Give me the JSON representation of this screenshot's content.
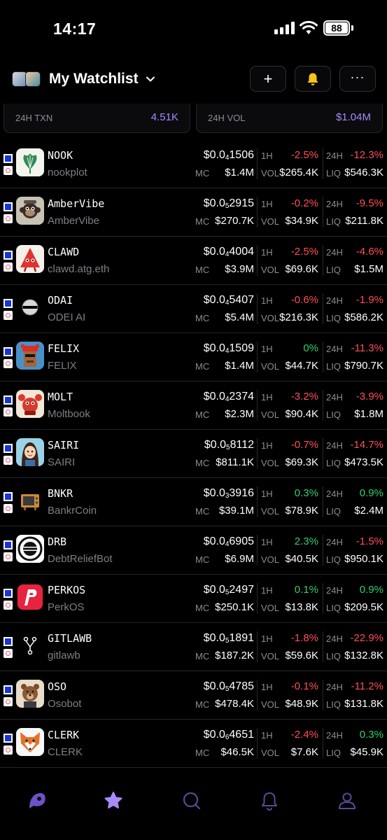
{
  "status_bar": {
    "time": "14:17",
    "battery": "88"
  },
  "header": {
    "title": "My Watchlist"
  },
  "stats": {
    "txn_label": "24H TXN",
    "txn_value": "4.51K",
    "vol_label": "24H VOL",
    "vol_value": "$1.04M"
  },
  "labels": {
    "mc": "MC",
    "vol": "VOL",
    "h1": "1H",
    "h24": "24H",
    "liq": "LIQ"
  },
  "colors": {
    "accent": "#a78bfa",
    "positive": "#2fd16b",
    "negative": "#ff4d5a"
  },
  "tokens": [
    {
      "symbol": "NOOK",
      "name": "nookplot",
      "price_prefix": "$0.0",
      "price_zeros": "4",
      "price_digits": "1506",
      "mc": "$1.4M",
      "change_1h": "-2.5%",
      "change_1h_dir": "neg",
      "vol": "$265.4K",
      "change_24h": "-12.3%",
      "change_24h_dir": "neg",
      "liq": "$546.3K",
      "icon": "ginkgo-leaf-icon"
    },
    {
      "symbol": "AmberVibe",
      "name": "AmberVibe",
      "price_prefix": "$0.0",
      "price_zeros": "5",
      "price_digits": "2915",
      "mc": "$270.7K",
      "change_1h": "-0.2%",
      "change_1h_dir": "neg",
      "vol": "$34.9K",
      "change_24h": "-9.5%",
      "change_24h_dir": "neg",
      "liq": "$211.8K",
      "icon": "monkey-avatar-icon"
    },
    {
      "symbol": "CLAWD",
      "name": "clawd.atg.eth",
      "price_prefix": "$0.0",
      "price_zeros": "4",
      "price_digits": "4004",
      "mc": "$3.9M",
      "change_1h": "-2.5%",
      "change_1h_dir": "neg",
      "vol": "$69.6K",
      "change_24h": "-4.6%",
      "change_24h_dir": "neg",
      "liq": "$1.5M",
      "icon": "red-claw-icon"
    },
    {
      "symbol": "ODAI",
      "name": "ODEI AI",
      "price_prefix": "$0.0",
      "price_zeros": "4",
      "price_digits": "5407",
      "mc": "$5.4M",
      "change_1h": "-0.6%",
      "change_1h_dir": "neg",
      "vol": "$216.3K",
      "change_24h": "-1.9%",
      "change_24h_dir": "neg",
      "liq": "$586.2K",
      "icon": "orb-icon"
    },
    {
      "symbol": "FELIX",
      "name": "FELIX",
      "price_prefix": "$0.0",
      "price_zeros": "4",
      "price_digits": "1509",
      "mc": "$1.4M",
      "change_1h": "0%",
      "change_1h_dir": "pos",
      "vol": "$44.7K",
      "change_24h": "-11.3%",
      "change_24h_dir": "neg",
      "liq": "$790.7K",
      "icon": "pixel-punk-icon"
    },
    {
      "symbol": "MOLT",
      "name": "Moltbook",
      "price_prefix": "$0.0",
      "price_zeros": "4",
      "price_digits": "2374",
      "mc": "$2.3M",
      "change_1h": "-3.2%",
      "change_1h_dir": "neg",
      "vol": "$90.4K",
      "change_24h": "-3.9%",
      "change_24h_dir": "neg",
      "liq": "$1.8M",
      "icon": "red-crab-icon"
    },
    {
      "symbol": "SAIRI",
      "name": "SAIRI",
      "price_prefix": "$0.0",
      "price_zeros": "5",
      "price_digits": "8112",
      "mc": "$811.1K",
      "change_1h": "-0.7%",
      "change_1h_dir": "neg",
      "vol": "$69.3K",
      "change_24h": "-14.7%",
      "change_24h_dir": "neg",
      "liq": "$473.5K",
      "icon": "girl-avatar-icon"
    },
    {
      "symbol": "BNKR",
      "name": "BankrCoin",
      "price_prefix": "$0.0",
      "price_zeros": "3",
      "price_digits": "3916",
      "mc": "$39.1M",
      "change_1h": "0.3%",
      "change_1h_dir": "pos",
      "vol": "$78.9K",
      "change_24h": "0.9%",
      "change_24h_dir": "pos",
      "liq": "$2.4M",
      "icon": "tv-icon"
    },
    {
      "symbol": "DRB",
      "name": "DebtReliefBot",
      "price_prefix": "$0.0",
      "price_zeros": "4",
      "price_digits": "6905",
      "mc": "$6.9M",
      "change_1h": "2.3%",
      "change_1h_dir": "pos",
      "vol": "$40.5K",
      "change_24h": "-1.5%",
      "change_24h_dir": "neg",
      "liq": "$950.1K",
      "icon": "seal-badge-icon"
    },
    {
      "symbol": "PERKOS",
      "name": "PerkOS",
      "price_prefix": "$0.0",
      "price_zeros": "5",
      "price_digits": "2497",
      "mc": "$250.1K",
      "change_1h": "0.1%",
      "change_1h_dir": "pos",
      "vol": "$13.8K",
      "change_24h": "0.9%",
      "change_24h_dir": "pos",
      "liq": "$209.5K",
      "icon": "p-logo-icon"
    },
    {
      "symbol": "GITLAWB",
      "name": "gitlawb",
      "price_prefix": "$0.0",
      "price_zeros": "5",
      "price_digits": "1891",
      "mc": "$187.2K",
      "change_1h": "-1.8%",
      "change_1h_dir": "neg",
      "vol": "$59.6K",
      "change_24h": "-22.9%",
      "change_24h_dir": "neg",
      "liq": "$132.8K",
      "icon": "git-branch-icon"
    },
    {
      "symbol": "OSO",
      "name": "Osobot",
      "price_prefix": "$0.0",
      "price_zeros": "5",
      "price_digits": "4785",
      "mc": "$478.4K",
      "change_1h": "-0.1%",
      "change_1h_dir": "neg",
      "vol": "$48.9K",
      "change_24h": "-11.2%",
      "change_24h_dir": "neg",
      "liq": "$131.8K",
      "icon": "bear-icon"
    },
    {
      "symbol": "CLERK",
      "name": "CLERK",
      "price_prefix": "$0.0",
      "price_zeros": "6",
      "price_digits": "4651",
      "mc": "$46.5K",
      "change_1h": "-2.4%",
      "change_1h_dir": "neg",
      "vol": "$7.6K",
      "change_24h": "0.3%",
      "change_24h_dir": "pos",
      "liq": "$45.9K",
      "icon": "fox-icon"
    }
  ],
  "nav": [
    {
      "icon": "logo-icon"
    },
    {
      "icon": "star-icon"
    },
    {
      "icon": "search-icon"
    },
    {
      "icon": "bell-icon"
    },
    {
      "icon": "profile-icon"
    }
  ]
}
